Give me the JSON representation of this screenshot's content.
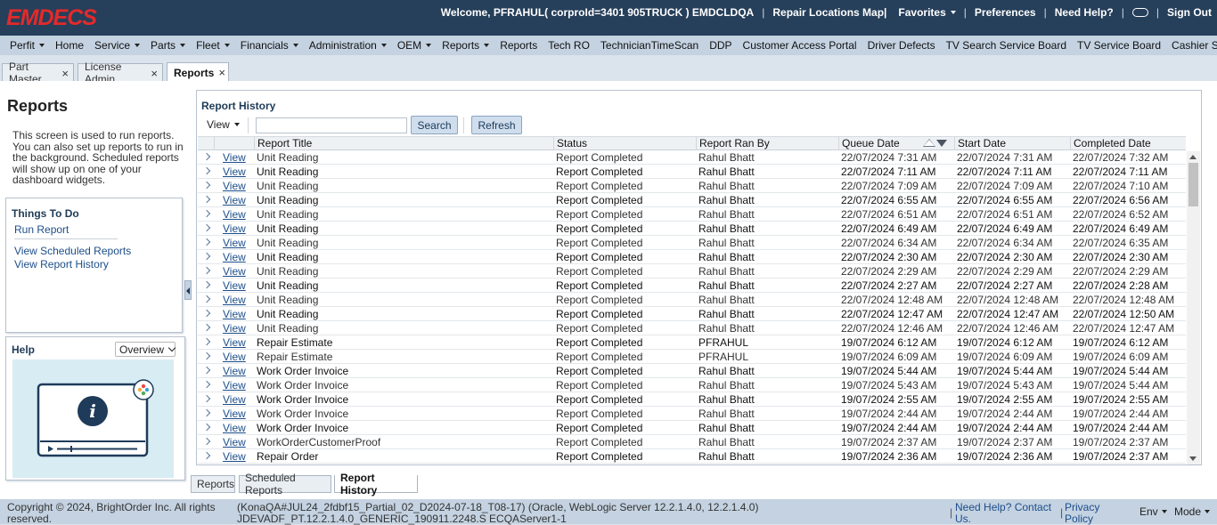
{
  "header": {
    "logo": "EMDECS",
    "welcome": "Welcome, PFRAHUL( corproId=3401 905TRUCK ) EMDCLDQA",
    "repair_locations": "Repair Locations Map|",
    "favorites": "Favorites",
    "preferences": "Preferences",
    "need_help": "Need Help?",
    "sign_out": "Sign Out"
  },
  "menu": [
    {
      "label": "Perfit",
      "dropdown": true
    },
    {
      "label": "Home",
      "dropdown": false
    },
    {
      "label": "Service",
      "dropdown": true
    },
    {
      "label": "Parts",
      "dropdown": true
    },
    {
      "label": "Fleet",
      "dropdown": true
    },
    {
      "label": "Financials",
      "dropdown": true
    },
    {
      "label": "Administration",
      "dropdown": true
    },
    {
      "label": "OEM",
      "dropdown": true
    },
    {
      "label": "Reports",
      "dropdown": true
    },
    {
      "label": "Reports",
      "dropdown": false
    },
    {
      "label": "Tech RO",
      "dropdown": false
    },
    {
      "label": "TechnicianTimeScan",
      "dropdown": false
    },
    {
      "label": "DDP",
      "dropdown": false
    },
    {
      "label": "Customer Access Portal",
      "dropdown": false
    },
    {
      "label": "Driver Defects",
      "dropdown": false
    },
    {
      "label": "TV Search Service Board",
      "dropdown": false
    },
    {
      "label": "TV Service Board",
      "dropdown": false
    },
    {
      "label": "Cashier Shift",
      "dropdown": false
    }
  ],
  "tabs": [
    {
      "label": "Part Master",
      "close": "×"
    },
    {
      "label": "License Admin",
      "close": "×"
    },
    {
      "label": "Reports",
      "close": "×"
    }
  ],
  "left": {
    "title": "Reports",
    "description": "This screen is used to run reports. You can also set up reports to run in the background. Scheduled reports will show up on one of your dashboard widgets.",
    "things_to_do": {
      "title": "Things To Do",
      "run_report": "Run Report",
      "view_scheduled": "View Scheduled Reports",
      "view_history": "View Report History"
    },
    "help": {
      "title": "Help",
      "select": "Overview"
    }
  },
  "panel": {
    "title": "Report History",
    "view_menu": "View",
    "search_value": "",
    "search_button": "Search",
    "refresh_button": "Refresh",
    "columns": {
      "title": "Report Title",
      "status": "Status",
      "ran_by": "Report Ran By",
      "queue": "Queue Date",
      "start": "Start Date",
      "completed": "Completed Date"
    },
    "rows": [
      {
        "link": "View",
        "title": "Unit Reading",
        "status": "Report Completed",
        "by": "Rahul Bhatt",
        "queue": "22/07/2024 7:31 AM",
        "start": "22/07/2024 7:31 AM",
        "completed": "22/07/2024 7:32 AM",
        "bold": false
      },
      {
        "link": "View",
        "title": "Unit Reading",
        "status": "Report Completed",
        "by": "Rahul Bhatt",
        "queue": "22/07/2024 7:11 AM",
        "start": "22/07/2024 7:11 AM",
        "completed": "22/07/2024 7:11 AM",
        "bold": true
      },
      {
        "link": "View",
        "title": "Unit Reading",
        "status": "Report Completed",
        "by": "Rahul Bhatt",
        "queue": "22/07/2024 7:09 AM",
        "start": "22/07/2024 7:09 AM",
        "completed": "22/07/2024 7:10 AM",
        "bold": false
      },
      {
        "link": "View",
        "title": "Unit Reading",
        "status": "Report Completed",
        "by": "Rahul Bhatt",
        "queue": "22/07/2024 6:55 AM",
        "start": "22/07/2024 6:55 AM",
        "completed": "22/07/2024 6:56 AM",
        "bold": true
      },
      {
        "link": "View",
        "title": "Unit Reading",
        "status": "Report Completed",
        "by": "Rahul Bhatt",
        "queue": "22/07/2024 6:51 AM",
        "start": "22/07/2024 6:51 AM",
        "completed": "22/07/2024 6:52 AM",
        "bold": false
      },
      {
        "link": "View",
        "title": "Unit Reading",
        "status": "Report Completed",
        "by": "Rahul Bhatt",
        "queue": "22/07/2024 6:49 AM",
        "start": "22/07/2024 6:49 AM",
        "completed": "22/07/2024 6:49 AM",
        "bold": true
      },
      {
        "link": "View",
        "title": "Unit Reading",
        "status": "Report Completed",
        "by": "Rahul Bhatt",
        "queue": "22/07/2024 6:34 AM",
        "start": "22/07/2024 6:34 AM",
        "completed": "22/07/2024 6:35 AM",
        "bold": false
      },
      {
        "link": "View",
        "title": "Unit Reading",
        "status": "Report Completed",
        "by": "Rahul Bhatt",
        "queue": "22/07/2024 2:30 AM",
        "start": "22/07/2024 2:30 AM",
        "completed": "22/07/2024 2:30 AM",
        "bold": true
      },
      {
        "link": "View",
        "title": "Unit Reading",
        "status": "Report Completed",
        "by": "Rahul Bhatt",
        "queue": "22/07/2024 2:29 AM",
        "start": "22/07/2024 2:29 AM",
        "completed": "22/07/2024 2:29 AM",
        "bold": false
      },
      {
        "link": "View",
        "title": "Unit Reading",
        "status": "Report Completed",
        "by": "Rahul Bhatt",
        "queue": "22/07/2024 2:27 AM",
        "start": "22/07/2024 2:27 AM",
        "completed": "22/07/2024 2:28 AM",
        "bold": true
      },
      {
        "link": "View",
        "title": "Unit Reading",
        "status": "Report Completed",
        "by": "Rahul Bhatt",
        "queue": "22/07/2024 12:48 AM",
        "start": "22/07/2024 12:48 AM",
        "completed": "22/07/2024 12:48 AM",
        "bold": false
      },
      {
        "link": "View",
        "title": "Unit Reading",
        "status": "Report Completed",
        "by": "Rahul Bhatt",
        "queue": "22/07/2024 12:47 AM",
        "start": "22/07/2024 12:47 AM",
        "completed": "22/07/2024 12:50 AM",
        "bold": true
      },
      {
        "link": "View",
        "title": "Unit Reading",
        "status": "Report Completed",
        "by": "Rahul Bhatt",
        "queue": "22/07/2024 12:46 AM",
        "start": "22/07/2024 12:46 AM",
        "completed": "22/07/2024 12:47 AM",
        "bold": false
      },
      {
        "link": "View",
        "title": "Repair Estimate",
        "status": "Report Completed",
        "by": "PFRAHUL",
        "queue": "19/07/2024 6:12 AM",
        "start": "19/07/2024 6:12 AM",
        "completed": "19/07/2024 6:12 AM",
        "bold": true
      },
      {
        "link": "View",
        "title": "Repair Estimate",
        "status": "Report Completed",
        "by": "PFRAHUL",
        "queue": "19/07/2024 6:09 AM",
        "start": "19/07/2024 6:09 AM",
        "completed": "19/07/2024 6:09 AM",
        "bold": false
      },
      {
        "link": "View",
        "title": "Work Order Invoice",
        "status": "Report Completed",
        "by": "Rahul Bhatt",
        "queue": "19/07/2024 5:44 AM",
        "start": "19/07/2024 5:44 AM",
        "completed": "19/07/2024 5:44 AM",
        "bold": true
      },
      {
        "link": "View",
        "title": "Work Order Invoice",
        "status": "Report Completed",
        "by": "Rahul Bhatt",
        "queue": "19/07/2024 5:43 AM",
        "start": "19/07/2024 5:43 AM",
        "completed": "19/07/2024 5:44 AM",
        "bold": false
      },
      {
        "link": "View",
        "title": "Work Order Invoice",
        "status": "Report Completed",
        "by": "Rahul Bhatt",
        "queue": "19/07/2024 2:55 AM",
        "start": "19/07/2024 2:55 AM",
        "completed": "19/07/2024 2:55 AM",
        "bold": true
      },
      {
        "link": "View",
        "title": "Work Order Invoice",
        "status": "Report Completed",
        "by": "Rahul Bhatt",
        "queue": "19/07/2024 2:44 AM",
        "start": "19/07/2024 2:44 AM",
        "completed": "19/07/2024 2:44 AM",
        "bold": false
      },
      {
        "link": "View",
        "title": "Work Order Invoice",
        "status": "Report Completed",
        "by": "Rahul Bhatt",
        "queue": "19/07/2024 2:44 AM",
        "start": "19/07/2024 2:44 AM",
        "completed": "19/07/2024 2:44 AM",
        "bold": true
      },
      {
        "link": "View",
        "title": "WorkOrderCustomerProof",
        "status": "Report Completed",
        "by": "Rahul Bhatt",
        "queue": "19/07/2024 2:37 AM",
        "start": "19/07/2024 2:37 AM",
        "completed": "19/07/2024 2:37 AM",
        "bold": false
      },
      {
        "link": "View",
        "title": "Repair Order",
        "status": "Report Completed",
        "by": "Rahul Bhatt",
        "queue": "19/07/2024 2:36 AM",
        "start": "19/07/2024 2:36 AM",
        "completed": "19/07/2024 2:37 AM",
        "bold": true
      }
    ]
  },
  "subtabs": [
    "Reports",
    "Scheduled Reports",
    "Report History"
  ],
  "footer": {
    "copyright": "Copyright © 2024, BrightOrder Inc. All rights reserved.",
    "version": "(KonaQA#JUL24_2fdbf15_Partial_02_D2024-07-18_T08-17) (Oracle, WebLogic Server 12.2.1.4.0, 12.2.1.4.0) JDEVADF_PT.12.2.1.4.0_GENERIC_190911.2248.S ECQAServer1-1",
    "need_help": "Need Help? Contact Us.",
    "privacy": "Privacy Policy",
    "env": "Env",
    "mode": "Mode"
  },
  "colors": {
    "header_bg": "#263f5a",
    "logo": "#e32a2a",
    "menu_bg": "#c4d2e1",
    "link": "#1d4e8a"
  }
}
